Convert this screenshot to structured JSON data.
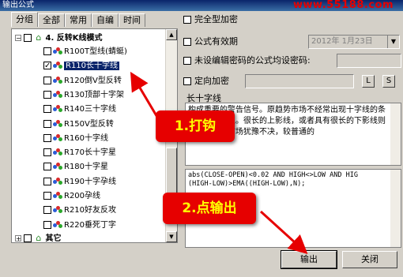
{
  "window": {
    "title": "输出公式"
  },
  "watermark": "www.55188.com",
  "tabs": [
    "分组",
    "全部",
    "常用",
    "自编",
    "时间"
  ],
  "tree": {
    "group_label": "4. 反转K线模式",
    "items": [
      {
        "label": "R100T型线(蜻蜓)",
        "checked": false
      },
      {
        "label": "R110长十字线",
        "checked": true,
        "selected": true
      },
      {
        "label": "R120倒V型反转",
        "checked": false
      },
      {
        "label": "R130顶部十字架",
        "checked": false
      },
      {
        "label": "R140三十字线",
        "checked": false
      },
      {
        "label": "R150V型反转",
        "checked": false
      },
      {
        "label": "R160十字线",
        "checked": false
      },
      {
        "label": "R170长十字星",
        "checked": false
      },
      {
        "label": "R180十字星",
        "checked": false
      },
      {
        "label": "R190十字孕线",
        "checked": false
      },
      {
        "label": "R200孕线",
        "checked": false
      },
      {
        "label": "R210好友反攻",
        "checked": false
      },
      {
        "label": "R220垂死丁字",
        "checked": false
      }
    ],
    "other_label": "其它"
  },
  "options": {
    "full_encrypt": "完全型加密",
    "valid_period": "公式有效期",
    "date_value": "2012年 1月23日",
    "no_password": "未设编辑密码的公式均设密码:",
    "fixed_encrypt": "定向加密",
    "btn_l": "L",
    "btn_s": "S"
  },
  "description": {
    "title": "长十字线",
    "text": "构成重要的警告信号。原趋势市场不经常出现十字线的条件有重要意义。很长的上影线，或者具有很长的下影线则更加意味着市场犹豫不决，较普通的"
  },
  "code": {
    "line1": "abs(CLOSE-OPEN)<0.02 AND HIGH<>LOW AND HIG",
    "line2": "(HIGH-LOW)>EMA((HIGH-LOW),N);"
  },
  "buttons": {
    "output": "输出",
    "close": "关闭"
  },
  "callouts": {
    "step1": "1.打钩",
    "step2": "2.点输出"
  },
  "colors": {
    "callout_bg": "#e60000",
    "callout_text": "#ffff00",
    "selection": "#0a246a"
  }
}
